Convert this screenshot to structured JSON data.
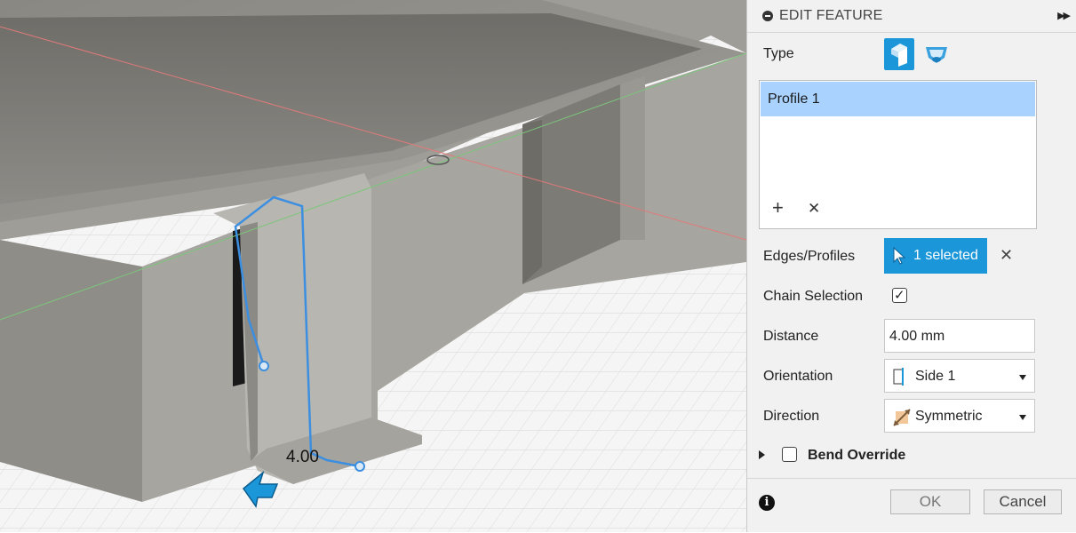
{
  "panel": {
    "title": "EDIT FEATURE",
    "type_label": "Type",
    "type_options": [
      "flange-icon",
      "hem-icon"
    ],
    "profiles": [
      "Profile 1"
    ],
    "edges_label": "Edges/Profiles",
    "edges_selection": "1 selected",
    "chain_label": "Chain Selection",
    "chain_checked": true,
    "distance_label": "Distance",
    "distance_value": "4.00 mm",
    "orientation_label": "Orientation",
    "orientation_value": "Side 1",
    "direction_label": "Direction",
    "direction_value": "Symmetric",
    "bend_override_label": "Bend Override",
    "bend_override_checked": false,
    "ok_label": "OK",
    "cancel_label": "Cancel"
  },
  "viewport": {
    "dimension_label": "4.00"
  },
  "colors": {
    "accent": "#1b97d9",
    "list_selection": "#a9d2ff",
    "sketch_line": "#3c8fe0"
  }
}
